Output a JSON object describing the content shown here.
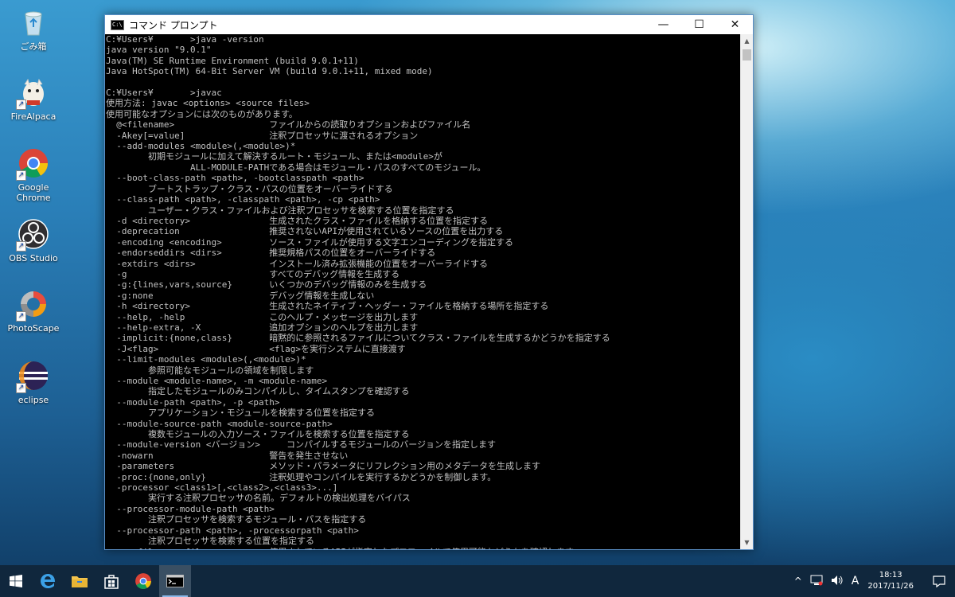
{
  "desktop": {
    "icons": [
      {
        "label": "ごみ箱",
        "icon": "recycle-bin-icon"
      },
      {
        "label": "FireAlpaca",
        "icon": "firealpaca-icon"
      },
      {
        "label": "Google Chrome",
        "icon": "chrome-icon"
      },
      {
        "label": "OBS Studio",
        "icon": "obs-icon"
      },
      {
        "label": "PhotoScape",
        "icon": "photoscape-icon"
      },
      {
        "label": "eclipse",
        "icon": "eclipse-icon"
      }
    ]
  },
  "window": {
    "title": "コマンド プロンプト",
    "controls": {
      "minimize": "—",
      "maximize": "☐",
      "close": "✕"
    },
    "console_lines": [
      "C:¥Users¥       >java -version",
      "java version \"9.0.1\"",
      "Java(TM) SE Runtime Environment (build 9.0.1+11)",
      "Java HotSpot(TM) 64-Bit Server VM (build 9.0.1+11, mixed mode)",
      "",
      "C:¥Users¥       >javac",
      "使用方法: javac <options> <source files>",
      "使用可能なオプションには次のものがあります。",
      "  @<filename>                  ファイルからの読取りオプションおよびファイル名",
      "  -Akey[=value]                注釈プロセッサに渡されるオプション",
      "  --add-modules <module>(,<module>)*",
      "        初期モジュールに加えて解決するルート・モジュール、または<module>が",
      "                ALL-MODULE-PATHである場合はモジュール・パスのすべてのモジュール。",
      "  --boot-class-path <path>, -bootclasspath <path>",
      "        ブートストラップ・クラス・パスの位置をオーバーライドする",
      "  --class-path <path>, -classpath <path>, -cp <path>",
      "        ユーザー・クラス・ファイルおよび注釈プロセッサを検索する位置を指定する",
      "  -d <directory>               生成されたクラス・ファイルを格納する位置を指定する",
      "  -deprecation                 推奨されないAPIが使用されているソースの位置を出力する",
      "  -encoding <encoding>         ソース・ファイルが使用する文字エンコーディングを指定する",
      "  -endorseddirs <dirs>         推奨規格パスの位置をオーバーライドする",
      "  -extdirs <dirs>              インストール済み拡張機能の位置をオーバーライドする",
      "  -g                           すべてのデバッグ情報を生成する",
      "  -g:{lines,vars,source}       いくつかのデバッグ情報のみを生成する",
      "  -g:none                      デバッグ情報を生成しない",
      "  -h <directory>               生成されたネイティブ・ヘッダー・ファイルを格納する場所を指定する",
      "  --help, -help                このヘルプ・メッセージを出力します",
      "  --help-extra, -X             追加オプションのヘルプを出力します",
      "  -implicit:{none,class}       暗黙的に参照されるファイルについてクラス・ファイルを生成するかどうかを指定する",
      "  -J<flag>                     <flag>を実行システムに直接渡す",
      "  --limit-modules <module>(,<module>)*",
      "        参照可能なモジュールの領域を制限します",
      "  --module <module-name>, -m <module-name>",
      "        指定したモジュールのみコンパイルし、タイムスタンプを確認する",
      "  --module-path <path>, -p <path>",
      "        アプリケーション・モジュールを検索する位置を指定する",
      "  --module-source-path <module-source-path>",
      "        複数モジュールの入力ソース・ファイルを検索する位置を指定する",
      "  --module-version <バージョン>     コンパイルするモジュールのバージョンを指定します",
      "  -nowarn                      警告を発生させない",
      "  -parameters                  メソッド・パラメータにリフレクション用のメタデータを生成します",
      "  -proc:{none,only}            注釈処理やコンパイルを実行するかどうかを制御します。",
      "  -processor <class1>[,<class2>,<class3>...]",
      "        実行する注釈プロセッサの名前。デフォルトの検出処理をバイパス",
      "  --processor-module-path <path>",
      "        注釈プロセッサを検索するモジュール・パスを指定する",
      "  --processor-path <path>, -processorpath <path>",
      "        注釈プロセッサを検索する位置を指定する",
      "  -profile <profile>           使用されているAPIが指定したプロファイルで使用可能かどうかを確認します"
    ]
  },
  "taskbar": {
    "apps": [
      "start-icon",
      "edge-icon",
      "file-explorer-icon",
      "store-icon",
      "chrome-icon",
      "cmd-icon"
    ],
    "tray": {
      "ime": "A",
      "time": "18:13",
      "date": "2017/11/26"
    }
  }
}
